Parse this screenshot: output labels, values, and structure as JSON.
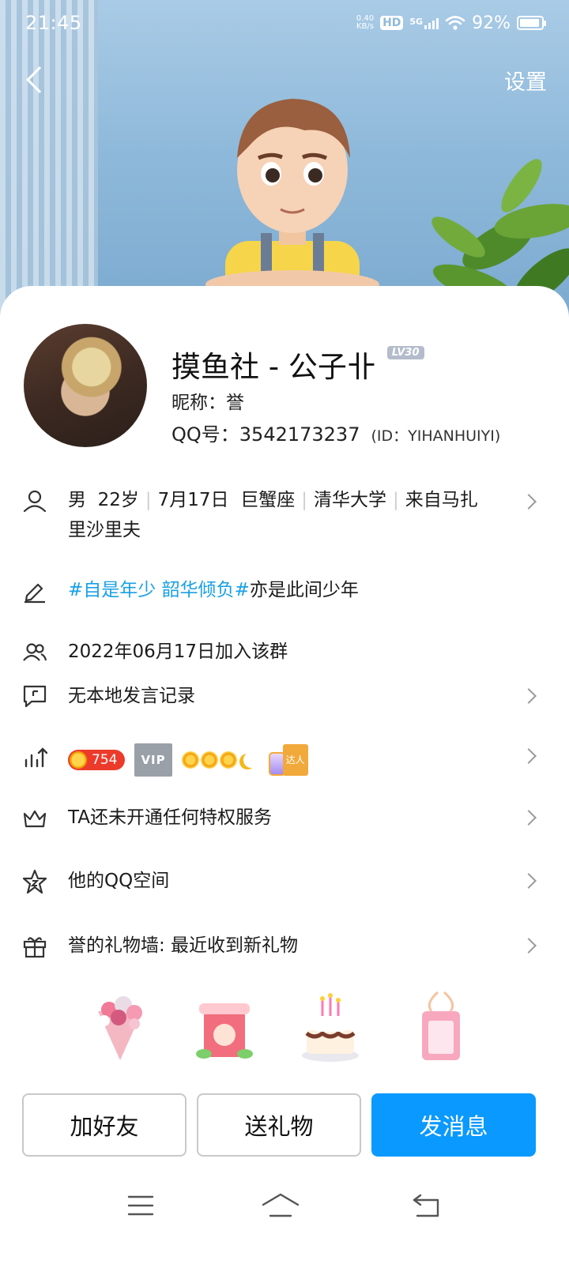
{
  "status_bar": {
    "time": "21:45",
    "net_speed_value": "0.40",
    "net_speed_unit": "KB/s",
    "hd": "HD",
    "network": "5G",
    "battery": "92%"
  },
  "nav": {
    "settings_label": "设置"
  },
  "profile": {
    "name": "摸鱼社 - 公子卝",
    "level": "LV30",
    "nickname": "昵称：誉",
    "qq_number": "QQ号：3542173237",
    "id": "(ID：YIHANHUIYI)"
  },
  "info": {
    "gender": "男",
    "age": "22岁",
    "birthday": "7月17日",
    "zodiac": "巨蟹座",
    "school": "清华大学",
    "hometown_line1": "来自马扎",
    "hometown_line2": "里沙里夫"
  },
  "signature": {
    "tag": "#自是年少 韶华倾负#",
    "text": "亦是此间少年"
  },
  "join_date": "2022年06月17日加入该群",
  "speech_record": "无本地发言记录",
  "level_badges": {
    "sun_count": "754",
    "vip": "VIP",
    "daren": "达人"
  },
  "privilege": "TA还未开通任何特权服务",
  "qzone": "他的QQ空间",
  "gift_wall": "誉的礼物墙: 最近收到新礼物",
  "gifts": [
    "bouquet-gift",
    "drink-cup-gift",
    "birthday-cake-gift",
    "charm-tag-gift"
  ],
  "buttons": {
    "add_friend": "加好友",
    "send_gift": "送礼物",
    "send_message": "发消息"
  },
  "colors": {
    "accent": "#0a99ff",
    "link": "#1aa0e6",
    "badge_red": "#ec3b2b"
  }
}
